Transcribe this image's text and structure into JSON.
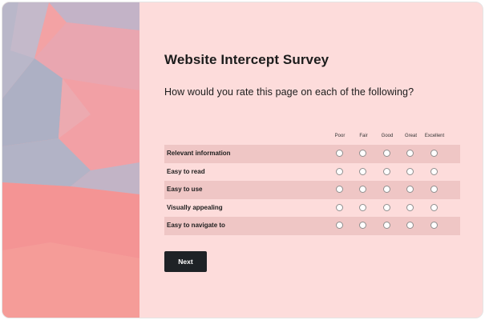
{
  "survey": {
    "title": "Website Intercept Survey",
    "question": "How would you rate this page on each of the following?",
    "columns": [
      "Poor",
      "Fair",
      "Good",
      "Great",
      "Excellent"
    ],
    "rows": [
      {
        "label": "Relevant information"
      },
      {
        "label": "Easy to read"
      },
      {
        "label": "Easy to use"
      },
      {
        "label": "Visually appealing"
      },
      {
        "label": "Easy to navigate to"
      }
    ],
    "next_label": "Next"
  },
  "colors": {
    "background": "#fddcdb",
    "row_shade": "#efc6c5",
    "button": "#1e2226",
    "art_pink": "#f49494",
    "art_lavender": "#b0b1c3"
  }
}
